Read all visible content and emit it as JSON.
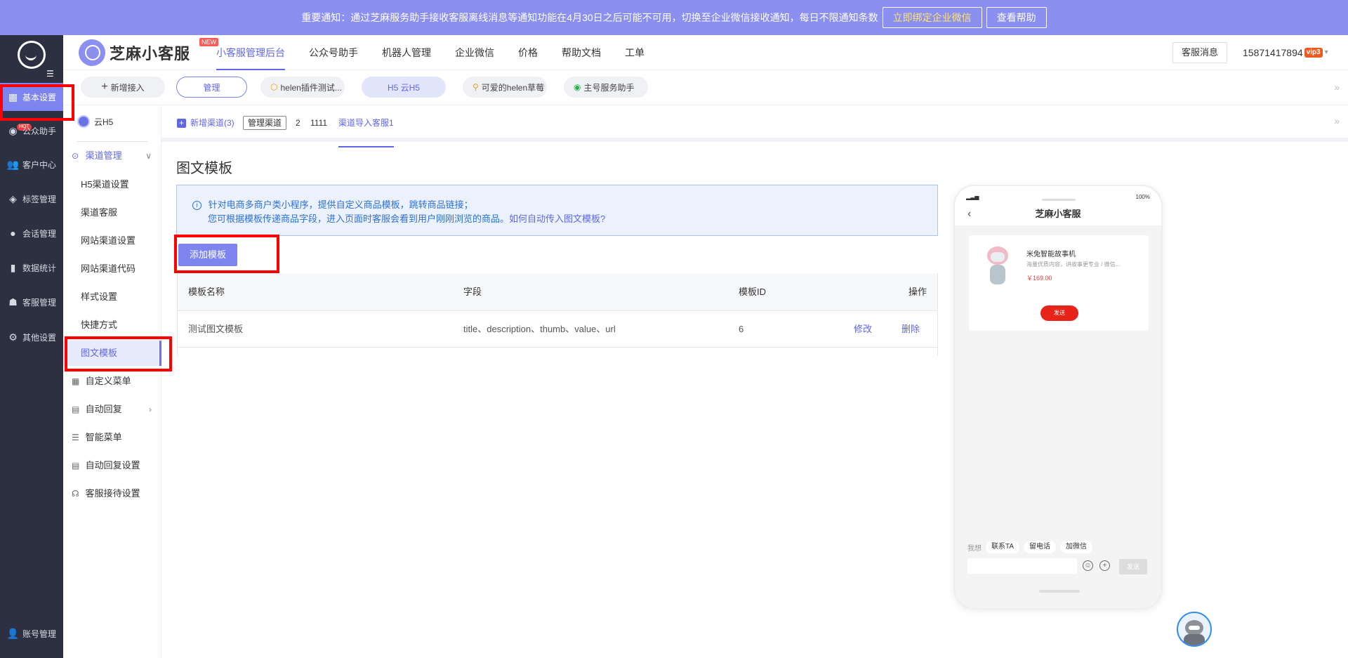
{
  "notice": {
    "text": "重要通知：通过芝麻服务助手接收客服离线消息等通知功能在4月30日之后可能不可用，切换至企业微信接收通知，每日不限通知条数",
    "bind_label": "立即绑定企业微信",
    "help_label": "查看帮助"
  },
  "leftnav": {
    "items": [
      {
        "label": "基本设置",
        "icon": "grid-icon"
      },
      {
        "label": "公众助手",
        "icon": "wechat-icon"
      },
      {
        "label": "客户中心",
        "icon": "users-icon"
      },
      {
        "label": "标签管理",
        "icon": "tag-icon"
      },
      {
        "label": "会话管理",
        "icon": "chat-icon"
      },
      {
        "label": "数据统计",
        "icon": "bar-chart-icon"
      },
      {
        "label": "客服管理",
        "icon": "robot-icon"
      },
      {
        "label": "其他设置",
        "icon": "gear-icon"
      }
    ],
    "hot_badge": "HOT",
    "account_label": "账号管理"
  },
  "header": {
    "brand": "芝麻小客服",
    "new_badge": "NEW",
    "tabs": [
      "小客服管理后台",
      "公众号助手",
      "机器人管理",
      "企业微信",
      "价格",
      "帮助文档",
      "工单"
    ],
    "kefu_msg": "客服消息",
    "phone": "15871417894",
    "vip_label": "vip3"
  },
  "channels": {
    "add_label": "新增接入",
    "manage_label": "管理",
    "items": [
      "helen插件测试...",
      "H5 云H5",
      "可爱的helen草莓",
      "主号服务助手"
    ]
  },
  "subside": {
    "account_name": "云H5",
    "group_label": "渠道管理",
    "group_items": [
      "H5渠道设置",
      "渠道客服",
      "网站渠道设置",
      "网站渠道代码",
      "样式设置",
      "快捷方式",
      "图文模板"
    ],
    "top_items": [
      "自定义菜单",
      "自动回复",
      "智能菜单",
      "自动回复设置",
      "客服接待设置"
    ]
  },
  "chtabs": {
    "new_channel": "新增渠道(3)",
    "manage": "管理渠道",
    "t2": "2",
    "t1111": "1111",
    "timport": "渠道导入客服1"
  },
  "main": {
    "title": "图文模板",
    "info_line1": "针对电商多商户类小程序，提供自定义商品模板，跳转商品链接；",
    "info_line2": "您可根据模板传递商品字段，进入页面时客服会看到用户刚刚浏览的商品。",
    "info_link": "如何自动传入图文模板?",
    "add_button": "添加模板",
    "table": {
      "headers": [
        "模板名称",
        "字段",
        "模板ID",
        "操作"
      ],
      "rows": [
        {
          "name": "测试图文模板",
          "fields": "title、description、thumb、value、url",
          "id": "6",
          "edit": "修改",
          "delete": "删除"
        }
      ]
    }
  },
  "phone_preview": {
    "status_right": "100%",
    "title": "芝麻小客服",
    "product_name": "米兔智能故事机",
    "product_desc": "海量优质内容，讲故事更专业 / 微信...",
    "product_price": "￥169.00",
    "send_label": "发送",
    "quick_label": "我想",
    "quick_items": [
      "联系TA",
      "留电话",
      "加微信"
    ],
    "send_button": "发送"
  }
}
